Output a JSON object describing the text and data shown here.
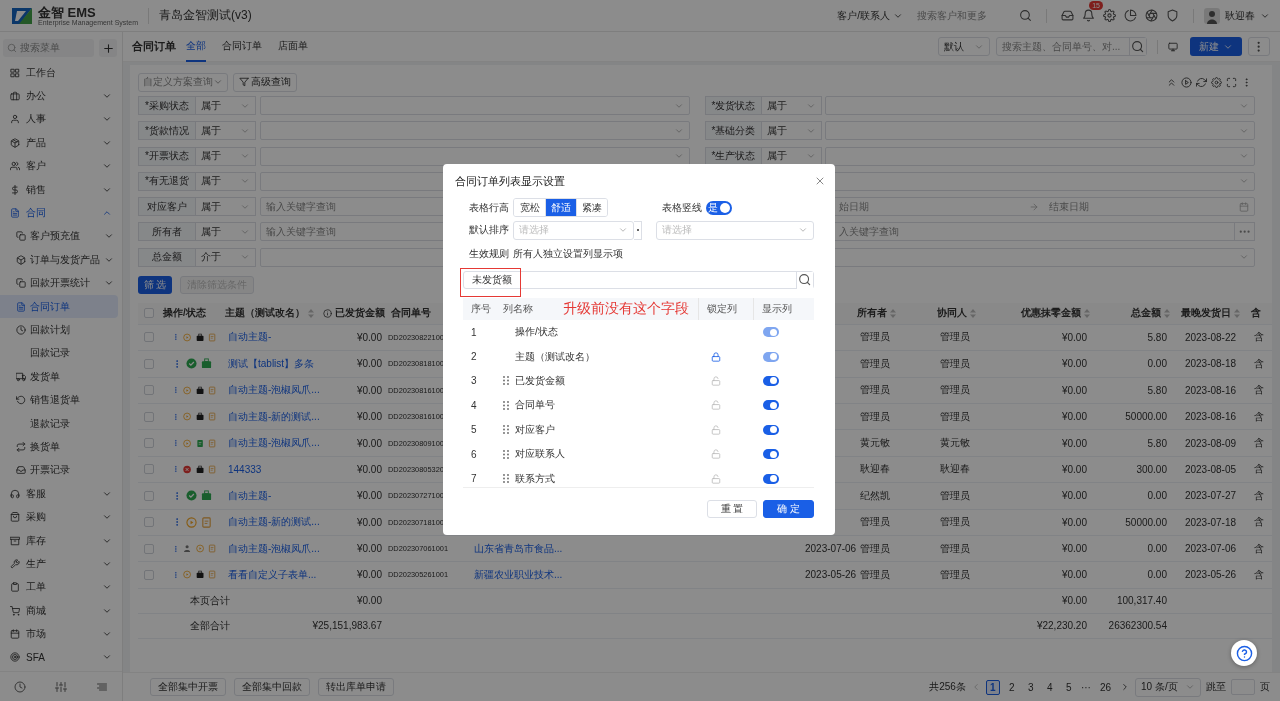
{
  "header": {
    "logo_text": "金智 EMS",
    "logo_subtitle": "Enterprise Management System",
    "company": "青岛金智测试(v3)",
    "search_scope": "客户/联系人",
    "search_placeholder": "搜索客户和更多",
    "notification_count": "15",
    "user_name": "耿迎春"
  },
  "sidebar": {
    "search_placeholder": "搜索菜单",
    "items": [
      {
        "label": "工作台",
        "kind": "link",
        "selected": false
      },
      {
        "label": "办公",
        "kind": "group",
        "expanded": false,
        "selected": false
      },
      {
        "label": "人事",
        "kind": "group",
        "expanded": false,
        "selected": false
      },
      {
        "label": "产品",
        "kind": "group",
        "expanded": false,
        "selected": false
      },
      {
        "label": "客户",
        "kind": "group",
        "expanded": false,
        "selected": false
      },
      {
        "label": "销售",
        "kind": "group",
        "expanded": false,
        "selected": false
      },
      {
        "label": "合同",
        "kind": "group",
        "expanded": true,
        "selected": true,
        "children": [
          {
            "label": "客户预充值",
            "kind": "group",
            "expanded": false,
            "has_icon": true,
            "selected": false
          },
          {
            "label": "订单与发货产品",
            "kind": "group",
            "expanded": false,
            "has_icon": true,
            "selected": false
          },
          {
            "label": "回款开票统计",
            "kind": "group",
            "expanded": false,
            "has_icon": true,
            "selected": false
          },
          {
            "label": "合同订单",
            "kind": "link",
            "has_icon": true,
            "selected": true
          },
          {
            "label": "回款计划",
            "kind": "link",
            "has_icon": true,
            "selected": false
          },
          {
            "label": "回款记录",
            "kind": "link",
            "has_icon": false,
            "selected": false
          },
          {
            "label": "发货单",
            "kind": "link",
            "has_icon": true,
            "selected": false
          },
          {
            "label": "销售退货单",
            "kind": "link",
            "has_icon": true,
            "selected": false
          },
          {
            "label": "退款记录",
            "kind": "link",
            "has_icon": false,
            "selected": false
          },
          {
            "label": "换货单",
            "kind": "link",
            "has_icon": true,
            "selected": false
          },
          {
            "label": "开票记录",
            "kind": "link",
            "has_icon": true,
            "selected": false
          }
        ]
      },
      {
        "label": "客服",
        "kind": "group",
        "expanded": false,
        "selected": false
      },
      {
        "label": "采购",
        "kind": "group",
        "expanded": false,
        "selected": false
      },
      {
        "label": "库存",
        "kind": "group",
        "expanded": false,
        "selected": false
      },
      {
        "label": "生产",
        "kind": "group",
        "expanded": false,
        "selected": false
      },
      {
        "label": "工单",
        "kind": "group",
        "expanded": false,
        "selected": false
      },
      {
        "label": "商城",
        "kind": "group",
        "expanded": false,
        "selected": false
      },
      {
        "label": "市场",
        "kind": "group",
        "expanded": false,
        "selected": false
      },
      {
        "label": "SFA",
        "kind": "group",
        "expanded": false,
        "selected": false
      }
    ]
  },
  "page": {
    "title": "合同订单",
    "tabs": [
      {
        "label": "全部",
        "selected": true
      },
      {
        "label": "合同订单",
        "selected": false
      },
      {
        "label": "店面单",
        "selected": false
      }
    ],
    "view_select": "默认",
    "search_placeholder": "搜索主题、合同单号、对...",
    "new_button": "新建"
  },
  "filters": {
    "scheme_placeholder": "自定义方案查询",
    "advanced": "高级查询",
    "rows": [
      {
        "label": "*采购状态",
        "operator": "属于",
        "right": {
          "kind": "labeled",
          "label": "*发货状态",
          "operator": "属于"
        }
      },
      {
        "label": "*货款情况",
        "operator": "属于",
        "right": {
          "kind": "labeled",
          "label": "*基础分类",
          "operator": "属于"
        }
      },
      {
        "label": "*开票状态",
        "operator": "属于",
        "right": {
          "kind": "labeled",
          "label": "*生产状态",
          "operator": "属于"
        }
      },
      {
        "label": "*有无退货",
        "operator": "属于",
        "right": {
          "kind": "select"
        }
      },
      {
        "label": "对应客户",
        "operator": "属于",
        "placeholder": "输入关键字查询",
        "right": {
          "kind": "date_range",
          "start": "始日期",
          "end": "结束日期"
        }
      },
      {
        "label": "所有者",
        "operator": "属于",
        "placeholder": "输入关键字查询",
        "right": {
          "kind": "picker",
          "placeholder": "入关键字查询"
        }
      },
      {
        "label": "总金额",
        "operator": "介于",
        "right": {
          "kind": "select"
        }
      }
    ],
    "apply": "筛 选",
    "clear": "清除筛选条件"
  },
  "table": {
    "columns": [
      {
        "label": "操作/状态",
        "sortable": false,
        "info": false
      },
      {
        "label": "主题（测试改名）",
        "sortable": true,
        "info": false
      },
      {
        "label": "已发货金额",
        "sortable": false,
        "info": true
      },
      {
        "label": "合同单号",
        "sortable": false,
        "info": false
      },
      {
        "label": "所有者",
        "sortable": true,
        "info": false
      },
      {
        "label": "协同人",
        "sortable": true,
        "info": false
      },
      {
        "label": "优惠抹零金额",
        "sortable": true,
        "info": false
      },
      {
        "label": "总金额",
        "sortable": true,
        "info": false
      },
      {
        "label": "最晚发货日",
        "sortable": true,
        "info": false
      },
      {
        "label": "含",
        "sortable": false,
        "info": false
      }
    ],
    "select_all_checked": false,
    "rows": [
      {
        "checked": false,
        "icons": [
          {
            "kind": "pending"
          },
          {
            "kind": "case"
          },
          {
            "kind": "doc"
          }
        ],
        "subject": "自动主题-",
        "shipped": "¥0.00",
        "order": "DD20230822100",
        "owner": "管理员",
        "co": "管理员",
        "discount": "¥0.00",
        "total": "5.80",
        "lastdate": "2023-08-22",
        "tax": "含"
      },
      {
        "checked": false,
        "icons": [
          {
            "kind": "approved"
          },
          {
            "kind": "case_green"
          }
        ],
        "subject": "测试【tablist】多条",
        "shipped": "¥0.00",
        "order": "DD20230818100",
        "owner": "管理员",
        "co": "管理员",
        "discount": "¥0.00",
        "total": "0.00",
        "lastdate": "2023-08-18",
        "tax": "含"
      },
      {
        "checked": false,
        "icons": [
          {
            "kind": "pending"
          },
          {
            "kind": "case"
          },
          {
            "kind": "doc"
          }
        ],
        "subject": "自动主题-泡椒凤爪...",
        "shipped": "¥0.00",
        "order": "DD20230816100",
        "owner": "管理员",
        "co": "管理员",
        "discount": "¥0.00",
        "total": "5.80",
        "lastdate": "2023-08-16",
        "tax": "含"
      },
      {
        "checked": false,
        "icons": [
          {
            "kind": "pending"
          },
          {
            "kind": "case"
          },
          {
            "kind": "doc"
          }
        ],
        "subject": "自动主题-新的测试...",
        "shipped": "¥0.00",
        "order": "DD20230816100",
        "owner": "管理员",
        "co": "管理员",
        "discount": "¥0.00",
        "total": "50000.00",
        "lastdate": "2023-08-16",
        "tax": "含"
      },
      {
        "checked": false,
        "icons": [
          {
            "kind": "pending"
          },
          {
            "kind": "doc_green"
          },
          {
            "kind": "doc"
          }
        ],
        "subject": "自动主题-泡椒凤爪...",
        "shipped": "¥0.00",
        "order": "DD20230809100",
        "owner": "黄元敏",
        "co": "黄元敏",
        "discount": "¥0.00",
        "total": "5.80",
        "lastdate": "2023-08-09",
        "tax": "含"
      },
      {
        "checked": false,
        "icons": [
          {
            "kind": "rejected"
          },
          {
            "kind": "case"
          },
          {
            "kind": "doc"
          }
        ],
        "subject": "144333",
        "shipped": "¥0.00",
        "order": "DD20230805320",
        "owner": "耿迎春",
        "co": "耿迎春",
        "discount": "¥0.00",
        "total": "300.00",
        "lastdate": "2023-08-05",
        "tax": "含"
      },
      {
        "checked": false,
        "icons": [
          {
            "kind": "approved"
          },
          {
            "kind": "case_green"
          }
        ],
        "subject": "自动主题-",
        "shipped": "¥0.00",
        "order": "DD20230727100",
        "owner": "纪然凯",
        "co": "管理员",
        "discount": "¥0.00",
        "total": "0.00",
        "lastdate": "2023-07-27",
        "tax": "含"
      },
      {
        "checked": false,
        "icons": [
          {
            "kind": "pending"
          },
          {
            "kind": "doc"
          }
        ],
        "subject": "自动主题-新的测试...",
        "shipped": "¥0.00",
        "order": "DD20230718100",
        "owner": "管理员",
        "co": "管理员",
        "discount": "¥0.00",
        "total": "50000.00",
        "lastdate": "2023-07-18",
        "tax": "含"
      },
      {
        "checked": false,
        "icons": [
          {
            "kind": "person"
          },
          {
            "kind": "pending"
          },
          {
            "kind": "doc"
          }
        ],
        "subject": "自动主题-泡椒凤爪...",
        "shipped": "¥0.00",
        "order": "DD202307061001",
        "customer": "山东省青岛市食品...",
        "date": "2023-07-06",
        "owner": "管理员",
        "co": "管理员",
        "discount": "¥0.00",
        "total": "0.00",
        "lastdate": "2023-07-06",
        "tax": "含"
      },
      {
        "checked": false,
        "icons": [
          {
            "kind": "pending"
          },
          {
            "kind": "case"
          },
          {
            "kind": "doc"
          }
        ],
        "subject": "看看自定义子表单...",
        "shipped": "¥0.00",
        "order": "DD202305261001",
        "customer": "新疆农业职业技术...",
        "date": "2023-05-26",
        "owner": "管理员",
        "co": "管理员",
        "discount": "¥0.00",
        "total": "0.00",
        "lastdate": "2023-05-26",
        "tax": "含"
      }
    ],
    "totals": [
      {
        "label": "本页合计",
        "shipped": "¥0.00",
        "discount": "¥0.00",
        "total": "100,317.40"
      },
      {
        "label": "全部合计",
        "shipped": "¥25,151,983.67",
        "discount": "¥22,230.20",
        "total": "26362300.54"
      }
    ]
  },
  "footer": {
    "buttons": [
      "全部集中开票",
      "全部集中回款",
      "转出库单申请"
    ],
    "total": "共256条",
    "pages": [
      {
        "label": "1",
        "kind": "page",
        "selected": true
      },
      {
        "label": "2",
        "kind": "page",
        "selected": false
      },
      {
        "label": "3",
        "kind": "page",
        "selected": false
      },
      {
        "label": "4",
        "kind": "page",
        "selected": false
      },
      {
        "label": "5",
        "kind": "page",
        "selected": false
      },
      {
        "label": "···",
        "kind": "ellipsis"
      },
      {
        "label": "26",
        "kind": "page",
        "selected": false
      }
    ],
    "page_size": "10 条/页",
    "jump_label": "跳至",
    "jump_suffix": "页"
  },
  "dialog": {
    "title": "合同订单列表显示设置",
    "row_height": {
      "label": "表格行高",
      "options": [
        {
          "label": "宽松",
          "selected": false
        },
        {
          "label": "舒适",
          "selected": true
        },
        {
          "label": "紧凑",
          "selected": false
        }
      ]
    },
    "vertical_lines": {
      "label": "表格竖线",
      "on": true,
      "switch_text": "是"
    },
    "default_sort": {
      "label": "默认排序",
      "field_placeholder": "请选择",
      "order_placeholder": "请选择"
    },
    "rule": {
      "label": "生效规则",
      "value": "所有人独立设置列显示项"
    },
    "column_search": {
      "value": "未发货额"
    },
    "annotation": "升级前没有这个字段",
    "list_header": [
      "序号",
      "列名称",
      "锁定列",
      "显示列"
    ],
    "columns": [
      {
        "index": "1",
        "name": "操作/状态",
        "draggable": false,
        "lockable": false,
        "visible": true,
        "disabled": true
      },
      {
        "index": "2",
        "name": "主题（测试改名）",
        "draggable": false,
        "lockable": true,
        "locked": true,
        "visible": true,
        "disabled": true
      },
      {
        "index": "3",
        "name": "已发货金额",
        "draggable": true,
        "lockable": true,
        "locked": false,
        "visible": true,
        "disabled": false
      },
      {
        "index": "4",
        "name": "合同单号",
        "draggable": true,
        "lockable": true,
        "locked": false,
        "visible": true,
        "disabled": false
      },
      {
        "index": "5",
        "name": "对应客户",
        "draggable": true,
        "lockable": true,
        "locked": false,
        "visible": true,
        "disabled": false
      },
      {
        "index": "6",
        "name": "对应联系人",
        "draggable": true,
        "lockable": true,
        "locked": false,
        "visible": true,
        "disabled": false
      },
      {
        "index": "7",
        "name": "联系方式",
        "draggable": true,
        "lockable": true,
        "locked": false,
        "visible": true,
        "disabled": false
      }
    ],
    "buttons": [
      {
        "label": "重 置",
        "kind": "default"
      },
      {
        "label": "确 定",
        "kind": "primary"
      }
    ]
  }
}
